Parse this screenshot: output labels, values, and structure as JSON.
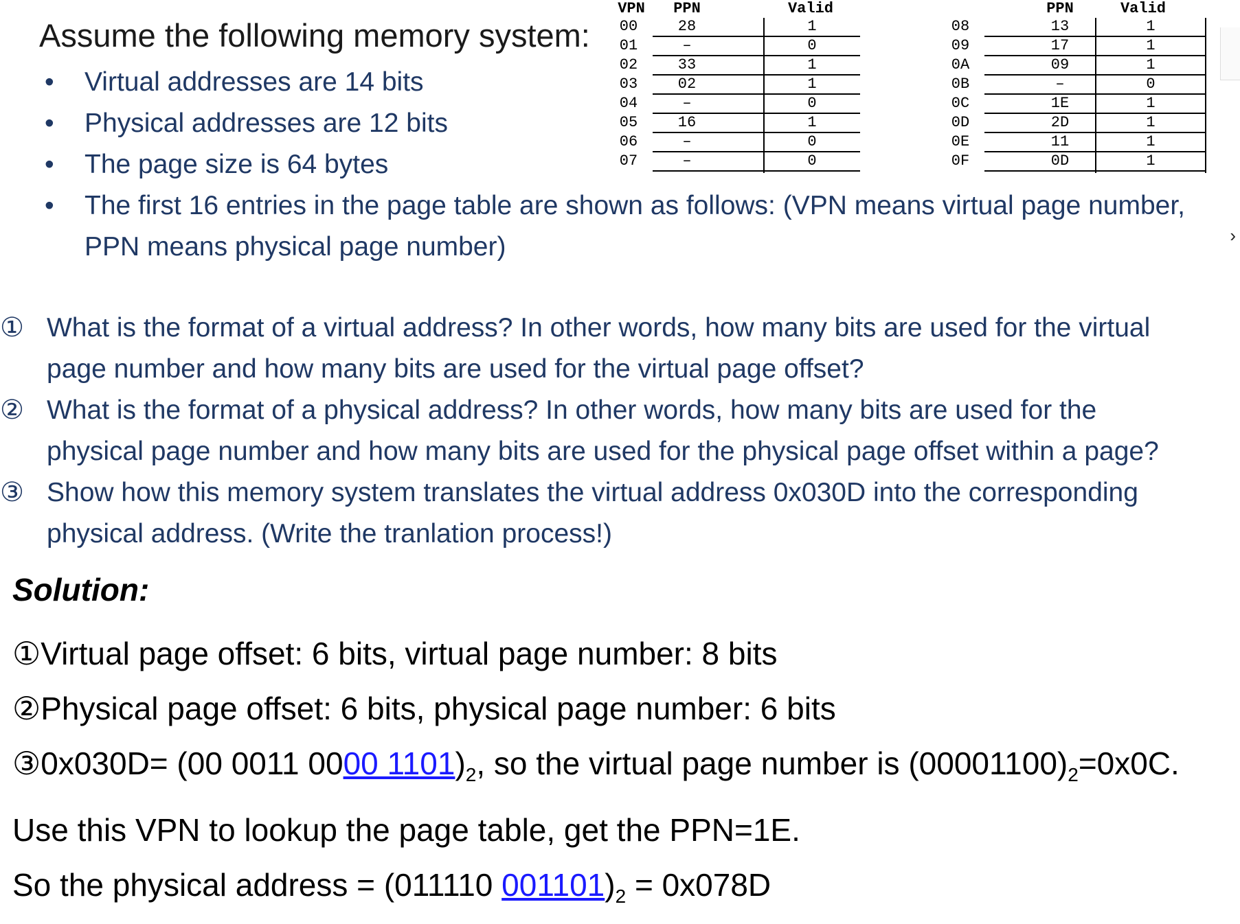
{
  "header": {
    "title": "Assume the following memory system:",
    "bullets": [
      "Virtual addresses are 14 bits",
      "Physical addresses are 12 bits",
      "The page size is 64 bytes",
      "The first 16 entries in the page table are shown as follows: (VPN means virtual page number,",
      "PPN means physical page number)"
    ]
  },
  "page_table": {
    "headers": {
      "vpn": "VPN",
      "ppn": "PPN",
      "valid": "Valid"
    },
    "left": [
      {
        "vpn": "00",
        "ppn": "28",
        "valid": "1"
      },
      {
        "vpn": "01",
        "ppn": "–",
        "valid": "0"
      },
      {
        "vpn": "02",
        "ppn": "33",
        "valid": "1"
      },
      {
        "vpn": "03",
        "ppn": "02",
        "valid": "1"
      },
      {
        "vpn": "04",
        "ppn": "–",
        "valid": "0"
      },
      {
        "vpn": "05",
        "ppn": "16",
        "valid": "1"
      },
      {
        "vpn": "06",
        "ppn": "–",
        "valid": "0"
      },
      {
        "vpn": "07",
        "ppn": "–",
        "valid": "0"
      }
    ],
    "right": [
      {
        "vpn": "08",
        "ppn": "13",
        "valid": "1"
      },
      {
        "vpn": "09",
        "ppn": "17",
        "valid": "1"
      },
      {
        "vpn": "0A",
        "ppn": "09",
        "valid": "1"
      },
      {
        "vpn": "0B",
        "ppn": "–",
        "valid": "0"
      },
      {
        "vpn": "0C",
        "ppn": "1E",
        "valid": "1"
      },
      {
        "vpn": "0D",
        "ppn": "2D",
        "valid": "1"
      },
      {
        "vpn": "0E",
        "ppn": "11",
        "valid": "1"
      },
      {
        "vpn": "0F",
        "ppn": "0D",
        "valid": "1"
      }
    ]
  },
  "questions": [
    {
      "num": "①",
      "line1": "What is the format of a virtual address? In other words, how many bits are used for the virtual",
      "line2": "page number and how many bits are used for the virtual page offset?"
    },
    {
      "num": "②",
      "line1": "What is the format of a physical address? In other words, how many bits are used for the",
      "line2": "physical page number and how many bits are used for the physical page offset within a page?"
    },
    {
      "num": "③",
      "line1": "Show how this memory system translates the virtual address 0x030D into the corresponding",
      "line2": "physical address. (Write the tranlation process!)"
    }
  ],
  "solution": {
    "title": "Solution:",
    "line1": "①Virtual page offset: 6 bits, virtual page number: 8 bits",
    "line2": "②Physical page offset: 6 bits, physical page number: 6 bits",
    "line3_a": "③0x030D= (00 0011 00",
    "line3_u": "00 1101",
    "line3_b": ")",
    "line3_sub1": "2",
    "line3_c": ", so the virtual page number is (00001100)",
    "line3_sub2": "2",
    "line3_d": "=0x0C.",
    "line4": "Use this VPN to lookup the page table, get the PPN=1E.",
    "line5_a": "So the physical address = (011110 ",
    "line5_u": "001101",
    "line5_b": ")",
    "line5_sub": "2",
    "line5_c": " = 0x078D"
  }
}
